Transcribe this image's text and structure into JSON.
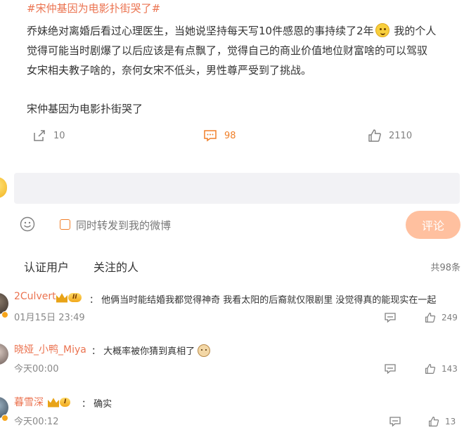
{
  "post": {
    "hashtag": "#宋仲基因为电影扑街哭了#",
    "line1": "乔妹绝对离婚后看过心理医生，当她说坚持每天写10件感恩的事持续了2年",
    "line1_tail": "我的个人",
    "line2": "觉得可能当时剧爆了以后应该是有点飘了，觉得自己的商业价值地位财富啥的可以驾驭",
    "line3": "女宋相夫教子啥的，奈何女宋不低头，男性尊严受到了挑战。",
    "line4": "宋仲基因为电影扑街哭了",
    "emoji_icon": "smile-emoji"
  },
  "actions": {
    "forward_count": "10",
    "comment_count": "98",
    "like_count": "2110"
  },
  "composer": {
    "forward_label": "同时转发到我的微博",
    "submit_label": "评论"
  },
  "filters": {
    "tab_verified": "认证用户",
    "tab_following": "关注的人",
    "total": "共98条"
  },
  "comments": [
    {
      "user": "2Culvert",
      "level": "II",
      "text": "： 他俩当时能结婚我都觉得神奇 我看太阳的后裔就仅限剧里 没觉得真的能现实在一起",
      "time": "01月15日 23:49",
      "likes": "249"
    },
    {
      "user": "晓娅_小鸭_Miya",
      "text": "： 大概率被你猜到真相了",
      "time": "今天00:00",
      "likes": "143"
    },
    {
      "user": "暮雪深",
      "level": "I",
      "text": "： 确实",
      "time": "今天00:12",
      "likes": "13"
    }
  ],
  "colors": {
    "accent": "#eb7350",
    "comment_active": "#f07f28",
    "submit_disabled": "#ffc09f",
    "input_bg": "#f2f2f5"
  }
}
